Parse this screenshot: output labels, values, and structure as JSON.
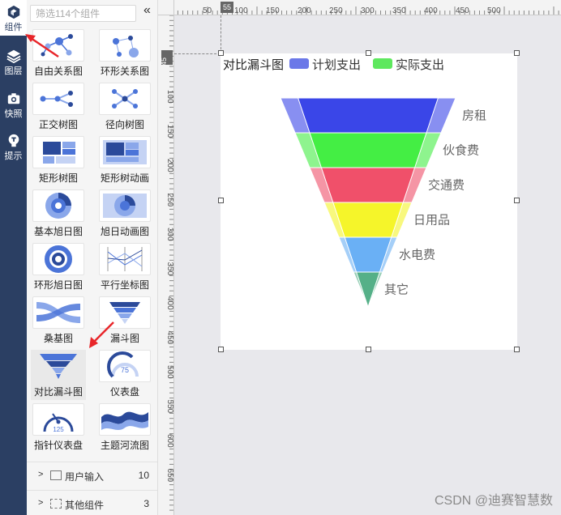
{
  "rail": {
    "items": [
      {
        "label": "组件",
        "icon": "cube-icon"
      },
      {
        "label": "图层",
        "icon": "layers-icon"
      },
      {
        "label": "快照",
        "icon": "camera-icon"
      },
      {
        "label": "提示",
        "icon": "lightbulb-icon"
      }
    ]
  },
  "panel": {
    "search_placeholder": "筛选114个组件",
    "collapse_icon": "double-chevron-left-icon",
    "components": [
      {
        "label": "自由关系图"
      },
      {
        "label": "环形关系图"
      },
      {
        "label": "正交树图"
      },
      {
        "label": "径向树图"
      },
      {
        "label": "矩形树图"
      },
      {
        "label": "矩形树动画"
      },
      {
        "label": "基本旭日图"
      },
      {
        "label": "旭日动画图"
      },
      {
        "label": "环形旭日图"
      },
      {
        "label": "平行坐标图"
      },
      {
        "label": "桑基图"
      },
      {
        "label": "漏斗图"
      },
      {
        "label": "对比漏斗图"
      },
      {
        "label": "仪表盘"
      },
      {
        "label": "指针仪表盘"
      },
      {
        "label": "主题河流图"
      }
    ],
    "categories": [
      {
        "label": "用户输入",
        "count": "10"
      },
      {
        "label": "其他组件",
        "count": "3"
      }
    ],
    "gauge_value": "75",
    "gauge2_value": "125"
  },
  "ruler": {
    "top_marker": "55",
    "left_marker": "45",
    "top_labels": [
      "50",
      "100",
      "150",
      "200",
      "250",
      "300",
      "350",
      "400",
      "450",
      "500"
    ],
    "left_labels": [
      "100",
      "150",
      "200",
      "250",
      "300",
      "350",
      "400",
      "450",
      "500",
      "550",
      "600",
      "650"
    ]
  },
  "chart_data": {
    "type": "funnel",
    "title": "对比漏斗图",
    "series": [
      {
        "name": "计划支出",
        "color": "#6b78e8"
      },
      {
        "name": "实际支出",
        "color": "#5ee85e"
      }
    ],
    "categories": [
      "房租",
      "伙食费",
      "交通费",
      "日用品",
      "水电费",
      "其它"
    ],
    "colors": [
      "#3a46e8",
      "#44ee44",
      "#f0506a",
      "#f5f52a",
      "#6ab0f5",
      "#55b088"
    ]
  },
  "watermark": "CSDN @迪赛智慧数"
}
